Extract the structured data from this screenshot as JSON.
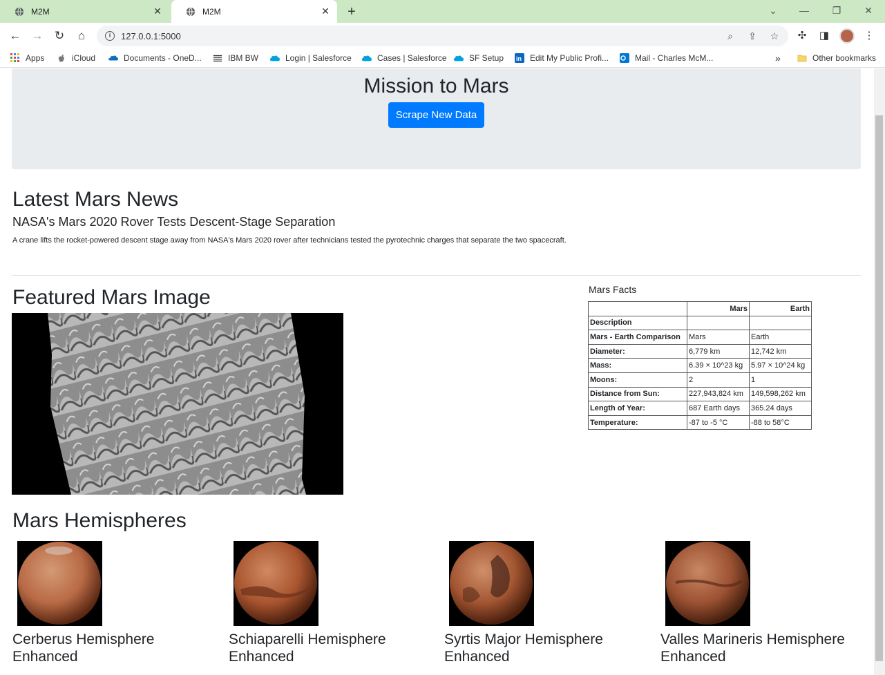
{
  "browser": {
    "tabs": [
      {
        "title": "M2M"
      },
      {
        "title": "M2M"
      }
    ],
    "url": "127.0.0.1:5000",
    "bookmarks": [
      {
        "label": "Apps",
        "icon": "apps-grid-icon"
      },
      {
        "label": "iCloud",
        "icon": "apple-icon"
      },
      {
        "label": "Documents - OneD...",
        "icon": "onedrive-cloud-icon"
      },
      {
        "label": "IBM BW",
        "icon": "ibm-icon"
      },
      {
        "label": "Login | Salesforce",
        "icon": "salesforce-cloud-icon"
      },
      {
        "label": "Cases | Salesforce",
        "icon": "salesforce-cloud-icon"
      },
      {
        "label": "SF Setup",
        "icon": "salesforce-cloud-icon"
      },
      {
        "label": "Edit My Public Profi...",
        "icon": "linkedin-icon"
      },
      {
        "label": "Mail - Charles McM...",
        "icon": "outlook-icon"
      }
    ],
    "other_bookmarks": "Other bookmarks",
    "colors": {
      "tab_strip": "#cde8c5",
      "accent": "#007bff"
    }
  },
  "page": {
    "title": "Mission to Mars",
    "scrape_button": "Scrape New Data",
    "news": {
      "heading": "Latest Mars News",
      "title": "NASA's Mars 2020 Rover Tests Descent-Stage Separation",
      "teaser": "A crane lifts the rocket-powered descent stage away from NASA's Mars 2020 rover after technicians tested the pyrotechnic charges that separate the two spacecraft."
    },
    "featured_heading": "Featured Mars Image",
    "facts": {
      "caption": "Mars Facts",
      "columns": [
        "Mars",
        "Earth"
      ],
      "index_label": "Description",
      "rows": [
        {
          "label": "Mars - Earth Comparison",
          "mars": "Mars",
          "earth": "Earth"
        },
        {
          "label": "Diameter:",
          "mars": "6,779 km",
          "earth": "12,742 km"
        },
        {
          "label": "Mass:",
          "mars": "6.39 × 10^23 kg",
          "earth": "5.97 × 10^24 kg"
        },
        {
          "label": "Moons:",
          "mars": "2",
          "earth": "1"
        },
        {
          "label": "Distance from Sun:",
          "mars": "227,943,824 km",
          "earth": "149,598,262 km"
        },
        {
          "label": "Length of Year:",
          "mars": "687 Earth days",
          "earth": "365.24 days"
        },
        {
          "label": "Temperature:",
          "mars": "-87 to -5 °C",
          "earth": "-88 to 58°C"
        }
      ]
    },
    "hemispheres": {
      "heading": "Mars Hemispheres",
      "items": [
        {
          "title": "Cerberus Hemisphere Enhanced"
        },
        {
          "title": "Schiaparelli Hemisphere Enhanced"
        },
        {
          "title": "Syrtis Major Hemisphere Enhanced"
        },
        {
          "title": "Valles Marineris Hemisphere Enhanced"
        }
      ]
    }
  }
}
